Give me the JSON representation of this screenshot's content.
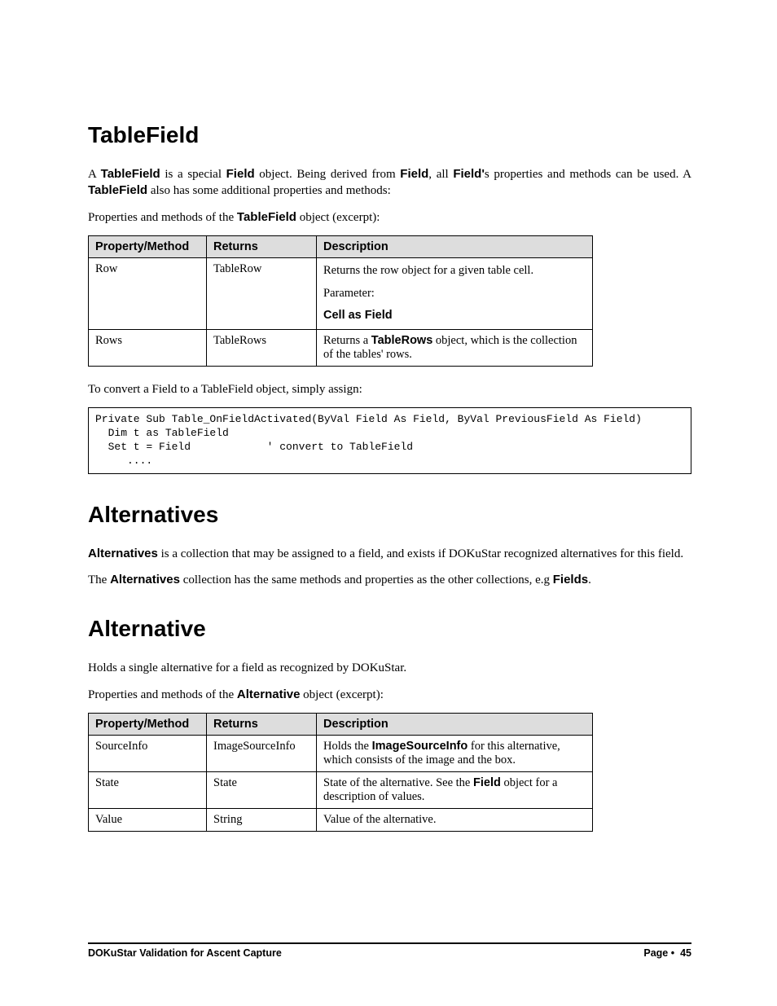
{
  "section1": {
    "heading": "TableField",
    "para1_parts": [
      "A ",
      "TableField",
      " is a special ",
      "Field",
      " object. Being derived from ",
      "Field",
      ",  all ",
      "Field'",
      "s properties and methods can be used. A ",
      "TableField",
      " also has some additional properties and methods:"
    ],
    "para2_parts": [
      "Properties and methods of the ",
      "TableField",
      " object (excerpt):"
    ],
    "table": {
      "headers": [
        "Property/Method",
        "Returns",
        "Description"
      ],
      "rows": [
        {
          "pm": "Row",
          "ret": "TableRow",
          "desc_line1": "Returns the row object for a given table cell.",
          "desc_line2": "Parameter:",
          "desc_line3_bold": "Cell as Field"
        },
        {
          "pm": "Rows",
          "ret": "TableRows",
          "desc_parts": [
            "Returns a ",
            "TableRows",
            " object, which is the collection of the tables' rows."
          ]
        }
      ]
    },
    "para3": "To convert a Field to a TableField object, simply assign:",
    "code": "Private Sub Table_OnFieldActivated(ByVal Field As Field, ByVal PreviousField As Field)\n  Dim t as TableField\n  Set t = Field            ' convert to TableField\n     ...."
  },
  "section2": {
    "heading": "Alternatives",
    "para1_parts": [
      "Alternatives",
      " is a collection that may be assigned to a field, and exists if DOKuStar recognized alternatives for this field."
    ],
    "para2_parts": [
      "The ",
      "Alternatives",
      " collection has the same methods and properties as the other collections, e.g ",
      "Fields",
      "."
    ]
  },
  "section3": {
    "heading": "Alternative",
    "para1": "Holds a single alternative for a field as recognized by DOKuStar.",
    "para2_parts": [
      "Properties and methods of the ",
      "Alternative",
      " object (excerpt):"
    ],
    "table": {
      "headers": [
        "Property/Method",
        "Returns",
        "Description"
      ],
      "rows": [
        {
          "pm": "SourceInfo",
          "ret": "ImageSourceInfo",
          "desc_parts": [
            "Holds the ",
            "ImageSourceInfo",
            " for this alternative, which consists of the image and the box."
          ]
        },
        {
          "pm": "State",
          "ret": "State",
          "desc_parts": [
            "State of the alternative. See the ",
            "Field",
            " object for a description of values."
          ]
        },
        {
          "pm": "Value",
          "ret": "String",
          "desc_plain": "Value of the alternative."
        }
      ]
    }
  },
  "footer": {
    "left": "DOKuStar Validation for Ascent Capture",
    "right_label": "Page",
    "right_sep": "•",
    "right_num": "45"
  }
}
